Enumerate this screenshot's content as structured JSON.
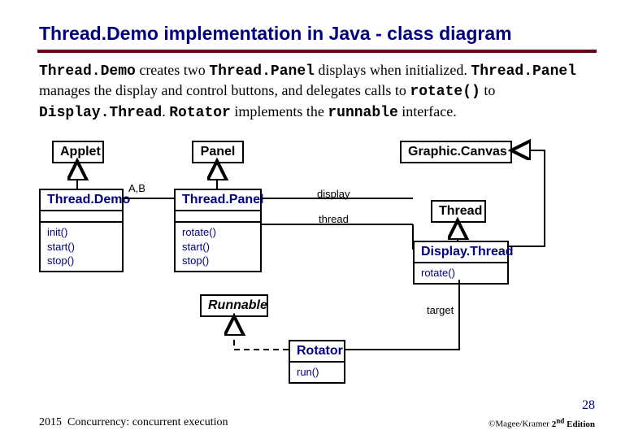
{
  "title": "Thread.Demo implementation in Java - class diagram",
  "desc_parts": {
    "p1": "Thread.Demo",
    "p2": " creates two ",
    "p3": "Thread.Panel",
    "p4": " displays when initialized. ",
    "p5": "Thread.Panel",
    "p6": " manages the display and control buttons, and delegates calls to ",
    "p7": "rotate()",
    "p8": " to ",
    "p9": "Display.Thread",
    "p10": ". ",
    "p11": "Rotator",
    "p12": " implements the ",
    "p13": "runnable",
    "p14": " interface."
  },
  "classes": {
    "applet": {
      "name": "Applet"
    },
    "panel": {
      "name": "Panel"
    },
    "graphiccanvas": {
      "name": "Graphic.Canvas"
    },
    "threaddemo": {
      "name": "Thread.Demo",
      "methods": "init()\nstart()\nstop()"
    },
    "threadpanel": {
      "name": "Thread.Panel",
      "methods": "rotate()\nstart()\nstop()"
    },
    "thread": {
      "name": "Thread"
    },
    "displaythread": {
      "name": "Display.Thread",
      "methods": "rotate()"
    },
    "runnable": {
      "name": "Runnable"
    },
    "rotator": {
      "name": "Rotator",
      "methods": "run()"
    }
  },
  "labels": {
    "ab": "A,B",
    "display": "display",
    "thread": "thread",
    "target": "target"
  },
  "footer": {
    "year": "2015",
    "course": "Concurrency: concurrent execution",
    "page": "28",
    "copy_pre": "©Magee/Kramer ",
    "copy_ed": "2",
    "copy_sup": "nd",
    "copy_post": " Edition"
  },
  "chart_data": {
    "type": "uml-class-diagram",
    "classes": [
      {
        "id": "Applet",
        "abstract": false,
        "methods": []
      },
      {
        "id": "Panel",
        "abstract": false,
        "methods": []
      },
      {
        "id": "Graphic.Canvas",
        "abstract": false,
        "methods": []
      },
      {
        "id": "Thread.Demo",
        "abstract": false,
        "methods": [
          "init()",
          "start()",
          "stop()"
        ]
      },
      {
        "id": "Thread.Panel",
        "abstract": false,
        "methods": [
          "rotate()",
          "start()",
          "stop()"
        ]
      },
      {
        "id": "Thread",
        "abstract": false,
        "methods": []
      },
      {
        "id": "Display.Thread",
        "abstract": false,
        "methods": [
          "rotate()"
        ]
      },
      {
        "id": "Runnable",
        "abstract": true,
        "interface": true,
        "methods": []
      },
      {
        "id": "Rotator",
        "abstract": false,
        "methods": [
          "run()"
        ]
      }
    ],
    "relations": [
      {
        "from": "Thread.Demo",
        "to": "Applet",
        "type": "generalization"
      },
      {
        "from": "Thread.Panel",
        "to": "Panel",
        "type": "generalization"
      },
      {
        "from": "Display.Thread",
        "to": "Graphic.Canvas",
        "type": "generalization"
      },
      {
        "from": "Display.Thread",
        "to": "Thread",
        "type": "generalization"
      },
      {
        "from": "Rotator",
        "to": "Runnable",
        "type": "realization"
      },
      {
        "from": "Thread.Demo",
        "to": "Thread.Panel",
        "type": "association",
        "label": "A,B"
      },
      {
        "from": "Thread.Panel",
        "to": "Display.Thread",
        "type": "association",
        "role": "display"
      },
      {
        "from": "Thread.Panel",
        "to": "Display.Thread",
        "type": "association",
        "role": "thread"
      },
      {
        "from": "Display.Thread",
        "to": "Rotator",
        "type": "association",
        "role": "target"
      }
    ]
  }
}
